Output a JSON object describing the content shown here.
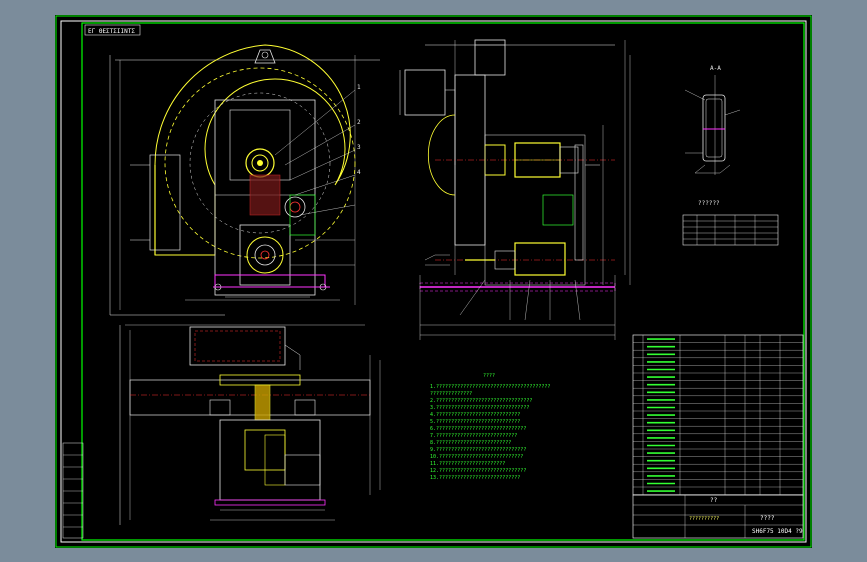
{
  "sheet": {
    "border_color": "#00ff00",
    "background": "#000000",
    "outer_background": "#7b8c9b"
  },
  "header_stamp": {
    "text": "ΕΓ ΘΕΣΤΣΙΙΝΤΣ"
  },
  "section_label": {
    "text": "A-A"
  },
  "detail_marks": {
    "m1": "1",
    "m2": "2",
    "m3": "3",
    "m4": "4"
  },
  "notes": {
    "title": "????",
    "lines": [
      "1.??????????????????????????????????????",
      "  ??????????????",
      "2.????????????????????????????????",
      "3.???????????????????????????????",
      "4.????????????????????????????",
      "5.????????????????????????????",
      "6.??????????????????????????????",
      "7.???????????????????????????",
      "8.?????????????????????????",
      "9.??????????????????????????????",
      "10.????????????????????????????",
      "11.??????????????????????",
      "12.?????????????????????????????",
      "13.???????????????????????????"
    ]
  },
  "bom_small_title": {
    "text": "??????"
  },
  "title_block": {
    "tt": "??",
    "drawing_no": "????",
    "company": "SH6F75 10D4 ?9",
    "project": "??????????"
  },
  "colors": {
    "white": "#e6e6e6",
    "yellow": "#ffff33",
    "green": "#33ff33",
    "magenta": "#ff33ff",
    "red": "#ff3333",
    "cyan": "#33ffff",
    "blue": "#5a5aff"
  }
}
